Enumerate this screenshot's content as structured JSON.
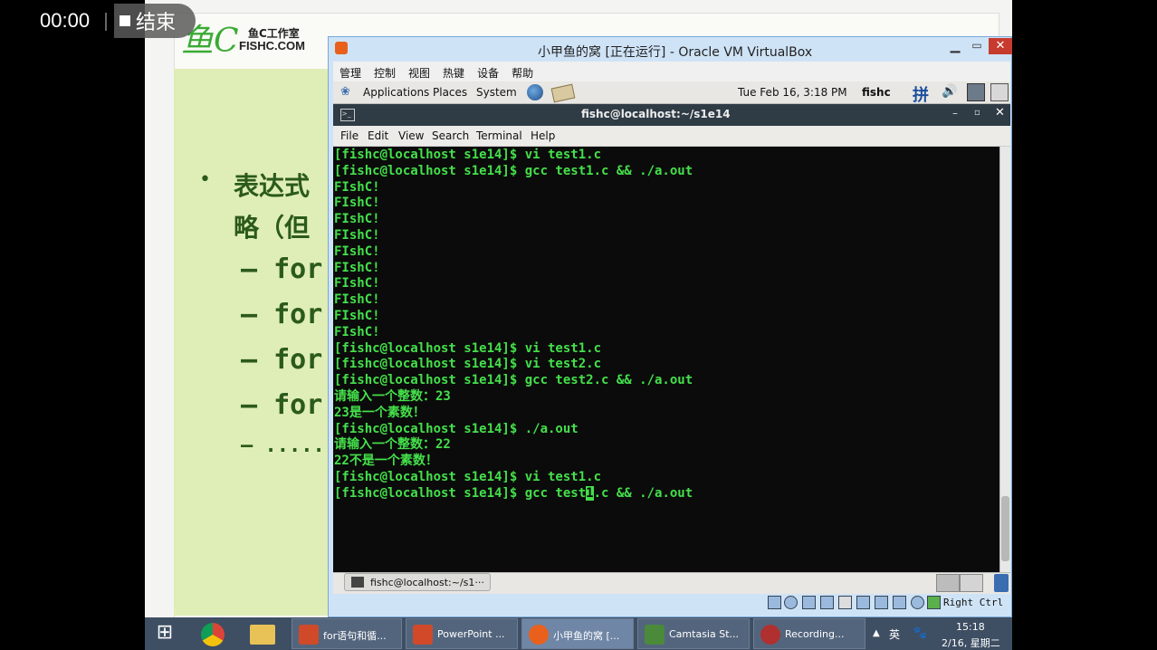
{
  "recording": {
    "time": "00:00",
    "end_label": "结束"
  },
  "slide": {
    "logo_top": "鱼C工作室",
    "logo_bottom": "FISHC.COM",
    "bullet": "•",
    "line1": "表达式",
    "line2": "略（但",
    "subitems": [
      "– for",
      "– for",
      "– for",
      "– for",
      "– ......"
    ]
  },
  "vbox": {
    "title": "小甲鱼的窝 [正在运行] - Oracle VM VirtualBox",
    "menu": [
      "管理",
      "控制",
      "视图",
      "热键",
      "设备",
      "帮助"
    ],
    "host_key": "Right Ctrl"
  },
  "guest_panel": {
    "applications": "Applications",
    "places": "Places",
    "system": "System",
    "datetime": "Tue Feb 16,  3:18 PM",
    "user": "fishc",
    "ime": "拼"
  },
  "terminal": {
    "title": "fishc@localhost:~/s1e14",
    "menu": [
      "File",
      "Edit",
      "View",
      "Search",
      "Terminal",
      "Help"
    ],
    "lines": [
      "[fishc@localhost s1e14]$ vi test1.c",
      "[fishc@localhost s1e14]$ gcc test1.c && ./a.out",
      "FIshC!",
      "FIshC!",
      "FIshC!",
      "FIshC!",
      "FIshC!",
      "FIshC!",
      "FIshC!",
      "FIshC!",
      "FIshC!",
      "FIshC!",
      "[fishc@localhost s1e14]$ vi test1.c",
      "[fishc@localhost s1e14]$ vi test2.c",
      "[fishc@localhost s1e14]$ gcc test2.c && ./a.out",
      "请输入一个整数：23",
      "23是一个素数！",
      "[fishc@localhost s1e14]$ ./a.out",
      "请输入一个整数：22",
      "22不是一个素数！",
      "[fishc@localhost s1e14]$ vi test1.c"
    ],
    "current_before": "[fishc@localhost s1e14]$ gcc test",
    "current_cursor": "1",
    "current_after": ".c && ./a.out"
  },
  "guest_taskbar": {
    "item": "fishc@localhost:~/s1···"
  },
  "host_taskbar": {
    "apps": [
      {
        "label": "for语句和循...",
        "icon_color": "#d04a2a"
      },
      {
        "label": "PowerPoint ...",
        "icon_color": "#d04a2a"
      },
      {
        "label": "小甲鱼的窝 [...",
        "icon_color": "#e8601c"
      },
      {
        "label": "Camtasia St...",
        "icon_color": "#4a8a3a"
      },
      {
        "label": "Recording...",
        "icon_color": "#b03030"
      }
    ],
    "tray_arrow": "▲",
    "tray_lang": "英",
    "tray_paw": "🐾",
    "clock_time": "15:18",
    "clock_date": "2/16, 星期二"
  }
}
